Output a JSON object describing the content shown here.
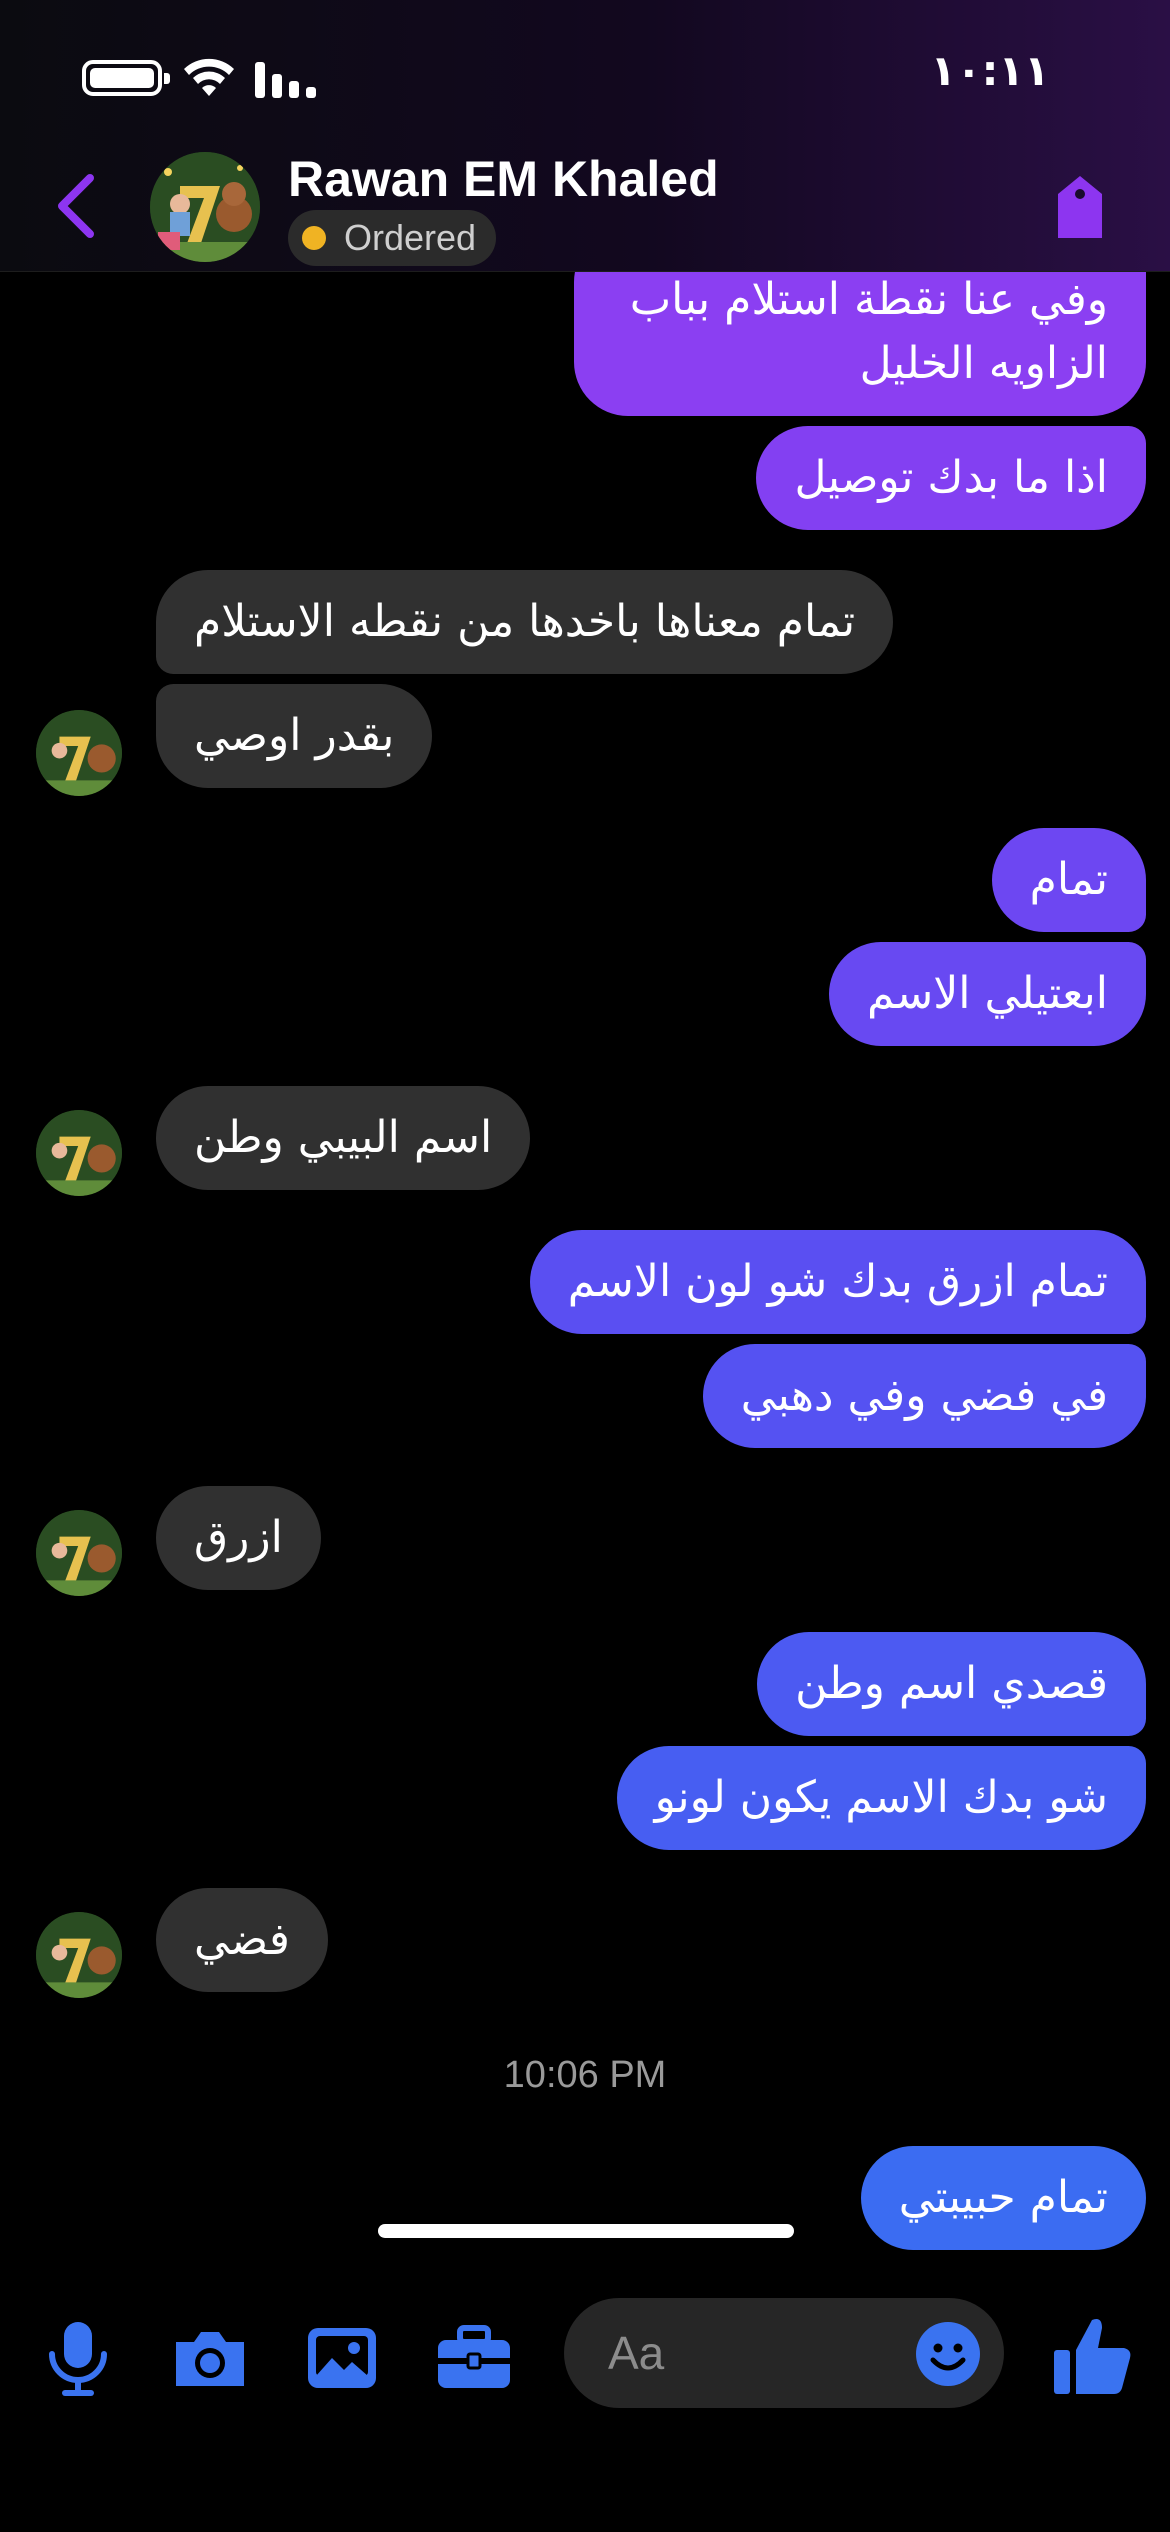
{
  "status_bar": {
    "time": "١٠:١١"
  },
  "header": {
    "contact_name": "Rawan EM Khaled",
    "order_status": "Ordered",
    "colors": {
      "accent": "#8d35f0",
      "status_dot": "#f0b323"
    }
  },
  "messages": [
    {
      "dir": "out",
      "text_lines": [
        "وفي عنا نقطة استلام بباب",
        "الزاويه الخليل"
      ],
      "color": "#8b3ff2"
    },
    {
      "dir": "out",
      "text": "اذا ما بدك توصيل",
      "color": "#8340f2"
    },
    {
      "dir": "in",
      "text": "تمام معناها باخدها من نقطه الاستلام"
    },
    {
      "dir": "in",
      "text": "بقدر اوصي"
    },
    {
      "dir": "out",
      "text": "تمام",
      "color": "#6d47f2"
    },
    {
      "dir": "out",
      "text": "ابعتيلي الاسم",
      "color": "#6849f2"
    },
    {
      "dir": "in",
      "text": "اسم البيبي وطن"
    },
    {
      "dir": "out",
      "text": "تمام ازرق بدك شو لون الاسم",
      "color": "#5a4ff2"
    },
    {
      "dir": "out",
      "text": "في فضي وفي دهبي",
      "color": "#5552f2"
    },
    {
      "dir": "in",
      "text": "ازرق"
    },
    {
      "dir": "out",
      "text": "قصدي اسم وطن",
      "color": "#4c5af2"
    },
    {
      "dir": "out",
      "text": "شو بدك الاسم يكون لونو",
      "color": "#475ef2"
    },
    {
      "dir": "in",
      "text": "فضي"
    },
    {
      "dir": "out",
      "text": "تمام حبيبتي",
      "color": "#3b6cf2"
    }
  ],
  "timestamp": "10:06 PM",
  "composer": {
    "placeholder": "Aa",
    "icons": [
      "microphone-icon",
      "camera-icon",
      "gallery-icon",
      "briefcase-icon",
      "emoji-icon",
      "thumbs-up-icon"
    ],
    "icon_color": "#3a73f0"
  }
}
